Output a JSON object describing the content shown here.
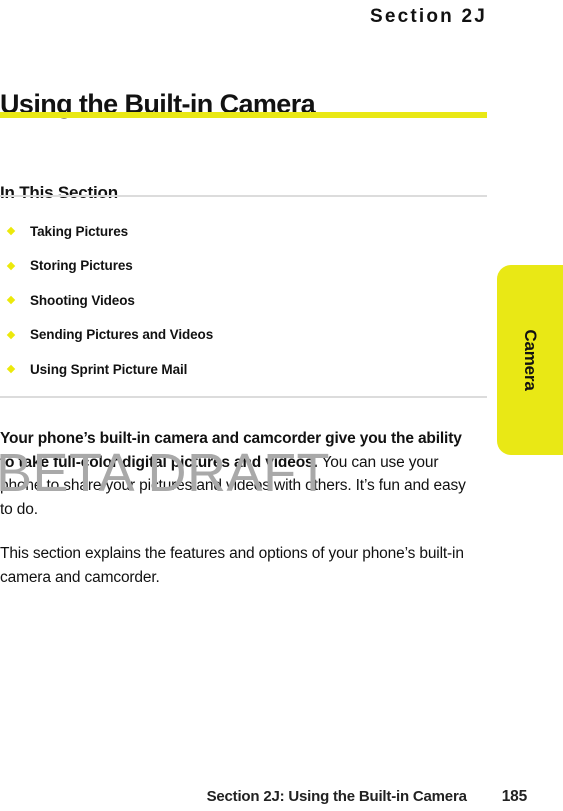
{
  "running_head": "Section 2J",
  "chapter_title": "Using the Built-in Camera",
  "section_heading": "In This Section",
  "toc": {
    "items": [
      {
        "label": "Taking Pictures"
      },
      {
        "label": "Storing Pictures"
      },
      {
        "label": "Shooting Videos"
      },
      {
        "label": "Sending Pictures and Videos"
      },
      {
        "label": "Using Sprint Picture Mail"
      }
    ]
  },
  "body": {
    "paragraph_1_bold": "Your phone’s built-in camera and camcorder give you the ability to take full-color digital pictures and videos.",
    "paragraph_1_rest": " You can use your phone to share your pictures and videos with others. It’s fun and easy to do.",
    "paragraph_2": "This section explains the features and options of your phone’s built-in camera and camcorder."
  },
  "watermark": "BETA DRAFT",
  "side_tab": {
    "label": "Camera"
  },
  "footer": {
    "title": "Section 2J: Using the Built-in Camera",
    "page_number": "185"
  },
  "colors": {
    "accent_yellow": "#e9e815",
    "bullet_yellow": "#ece90a",
    "rule_grey": "#dcdcdc",
    "watermark_grey": "#a9a9a9",
    "text_black": "#111111"
  }
}
